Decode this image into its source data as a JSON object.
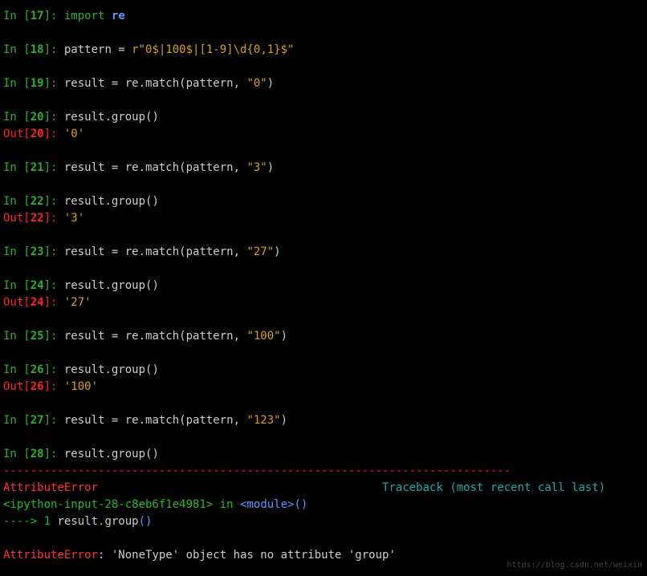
{
  "cells": [
    {
      "type": "in",
      "num": "17",
      "code_html": "<span class='kw-import'>import</span> <span class='kw-module'>re</span>"
    },
    {
      "type": "blank"
    },
    {
      "type": "in",
      "num": "18",
      "code_html": "pattern = <span class='str'>r\"0$|100$|[1-9]\\d{0,1}$\"</span>"
    },
    {
      "type": "blank"
    },
    {
      "type": "in",
      "num": "19",
      "code_html": "result = re.match(pattern, <span class='str'>\"0\"</span>)"
    },
    {
      "type": "blank"
    },
    {
      "type": "in",
      "num": "20",
      "code_html": "result.group()"
    },
    {
      "type": "out",
      "num": "20",
      "value": "'0'"
    },
    {
      "type": "blank"
    },
    {
      "type": "in",
      "num": "21",
      "code_html": "result = re.match(pattern, <span class='str'>\"3\"</span>)"
    },
    {
      "type": "blank"
    },
    {
      "type": "in",
      "num": "22",
      "code_html": "result.group()"
    },
    {
      "type": "out",
      "num": "22",
      "value": "'3'"
    },
    {
      "type": "blank"
    },
    {
      "type": "in",
      "num": "23",
      "code_html": "result = re.match(pattern, <span class='str'>\"27\"</span>)"
    },
    {
      "type": "blank"
    },
    {
      "type": "in",
      "num": "24",
      "code_html": "result.group()"
    },
    {
      "type": "out",
      "num": "24",
      "value": "'27'"
    },
    {
      "type": "blank"
    },
    {
      "type": "in",
      "num": "25",
      "code_html": "result = re.match(pattern, <span class='str'>\"100\"</span>)"
    },
    {
      "type": "blank"
    },
    {
      "type": "in",
      "num": "26",
      "code_html": "result.group()"
    },
    {
      "type": "out",
      "num": "26",
      "value": "'100'"
    },
    {
      "type": "blank"
    },
    {
      "type": "in",
      "num": "27",
      "code_html": "result = re.match(pattern, <span class='str'>\"123\"</span>)"
    },
    {
      "type": "blank"
    },
    {
      "type": "in",
      "num": "28",
      "code_html": "result.group()"
    }
  ],
  "error": {
    "sep": "---------------------------------------------------------------------------",
    "name": "AttributeError",
    "traceback_label": "Traceback (most recent call last)",
    "file": "<ipython-input-28-c8eb6f1e4981>",
    "in_word": "in",
    "module": "<module>",
    "parens": "()",
    "arrow": "----> 1 ",
    "call_obj": "result",
    "call_dot": ".",
    "call_method": "group",
    "final_name": "AttributeError",
    "final_msg": ": 'NoneType' object has no attribute 'group'"
  },
  "watermark": "https://blog.csdn.net/weixin"
}
